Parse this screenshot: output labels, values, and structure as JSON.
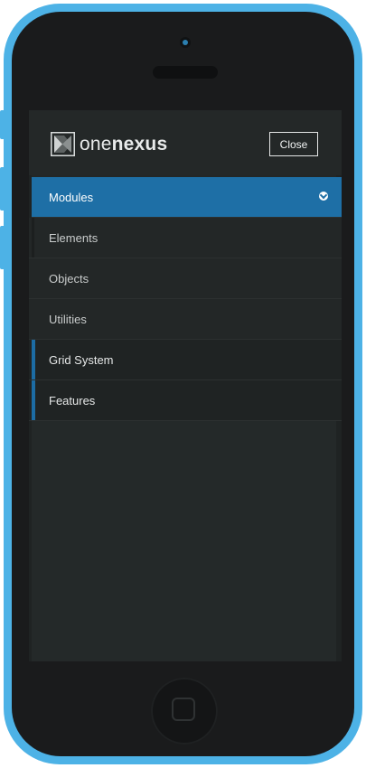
{
  "brand": {
    "name_light": "one",
    "name_bold": "nexus",
    "logo_icon": "onenexus-logo-icon"
  },
  "header": {
    "close_label": "Close"
  },
  "menu": {
    "items": [
      {
        "label": "Modules",
        "state": "active",
        "icon": "chevron-down-icon"
      },
      {
        "label": "Elements"
      },
      {
        "label": "Objects"
      },
      {
        "label": "Utilities"
      },
      {
        "label": "Grid System",
        "accent": true
      },
      {
        "label": "Features",
        "accent": true
      }
    ]
  },
  "colors": {
    "phone_shell": "#4db2e6",
    "active_item": "#1e6fa6",
    "menu_bg": "#232727"
  }
}
